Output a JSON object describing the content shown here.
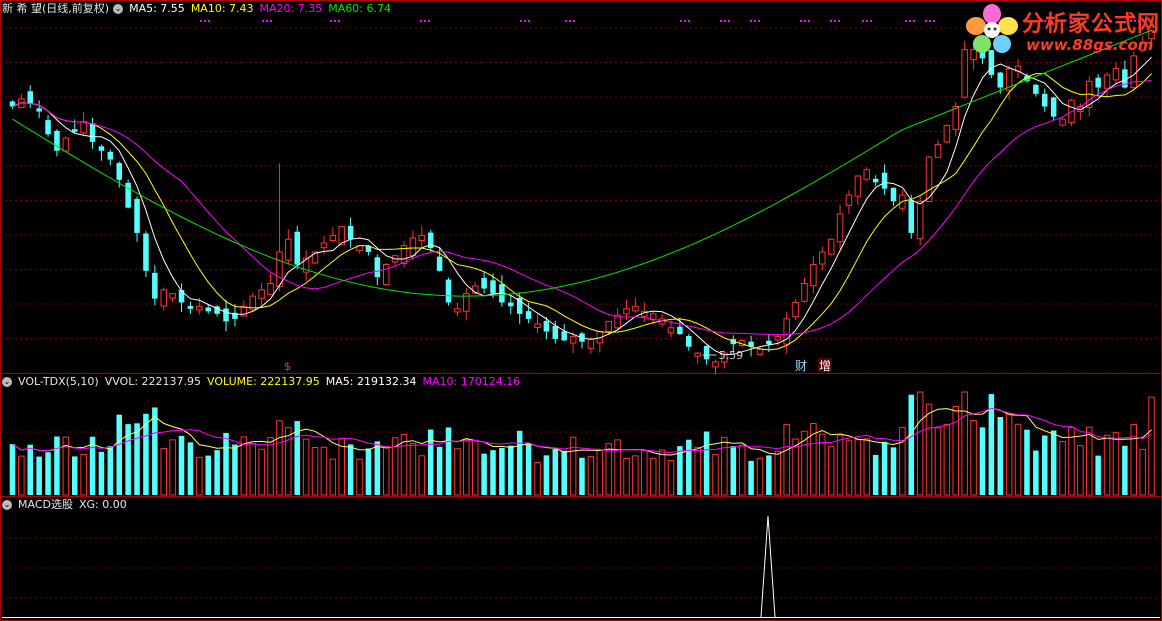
{
  "main_header": {
    "stock_name": "新 希 望",
    "adjust": "(日线,前复权)",
    "ma5": "MA5: 7.55",
    "ma10": "MA10: 7.43",
    "ma20": "MA20: 7.35",
    "ma60": "MA60: 6.74"
  },
  "vol_header": {
    "name": "VOL-TDX(5,10)",
    "vvol": "VVOL: 222137.95",
    "volume": "VOLUME: 222137.95",
    "ma5": "MA5: 219132.34",
    "ma10": "MA10: 170124.16"
  },
  "macd_header": {
    "name": "MACD选股",
    "xg": "XG: 0.00"
  },
  "annotations": {
    "low_label": "5.59",
    "cai_marker": "财",
    "zeng_marker": "增",
    "s_marker": "$"
  },
  "logo": {
    "text": "分析家公式网",
    "url": "www.88gs.com"
  },
  "colors": {
    "up": "#ff3232",
    "down": "#54ffff",
    "ma5": "#ffffff",
    "ma10": "#ffff00",
    "ma20": "#ff00ff",
    "ma60": "#00e600",
    "grid": "#7a0000",
    "border": "#b00000"
  },
  "chart_data": {
    "type": "candlestick",
    "price_ylim": [
      5.2,
      8.0
    ],
    "series_names": [
      "MA5",
      "MA10",
      "MA20",
      "MA60"
    ],
    "price_path": [
      7.3,
      7.36,
      7.32,
      7.26,
      7.08,
      6.95,
      7.05,
      7.1,
      7.18,
      7.02,
      6.95,
      6.88,
      6.72,
      6.5,
      6.3,
      6.0,
      5.78,
      5.85,
      5.82,
      5.75,
      5.7,
      5.72,
      5.68,
      5.66,
      5.6,
      5.62,
      5.72,
      5.8,
      5.85,
      5.9,
      6.15,
      6.25,
      6.05,
      6.1,
      6.15,
      6.22,
      6.28,
      6.35,
      6.25,
      6.2,
      6.15,
      5.95,
      6.05,
      6.12,
      6.2,
      6.26,
      6.28,
      6.18,
      6.0,
      5.75,
      5.7,
      5.82,
      5.88,
      5.86,
      5.82,
      5.75,
      5.72,
      5.66,
      5.62,
      5.58,
      5.52,
      5.46,
      5.45,
      5.48,
      5.44,
      5.46,
      5.52,
      5.6,
      5.65,
      5.7,
      5.72,
      5.68,
      5.66,
      5.62,
      5.55,
      5.5,
      5.4,
      5.35,
      5.3,
      5.28,
      5.35,
      5.42,
      5.45,
      5.4,
      5.38,
      5.42,
      5.48,
      5.62,
      5.75,
      5.9,
      6.05,
      6.15,
      6.25,
      6.45,
      6.6,
      6.75,
      6.8,
      6.7,
      6.65,
      6.55,
      6.6,
      6.3,
      6.55,
      6.9,
      7.0,
      7.15,
      7.3,
      7.75,
      7.75,
      7.68,
      7.55,
      7.45,
      7.6,
      7.62,
      7.5,
      7.4,
      7.3,
      7.22,
      7.2,
      7.35,
      7.3,
      7.5,
      7.45,
      7.55,
      7.6,
      7.45,
      7.7,
      7.8,
      7.9
    ]
  }
}
